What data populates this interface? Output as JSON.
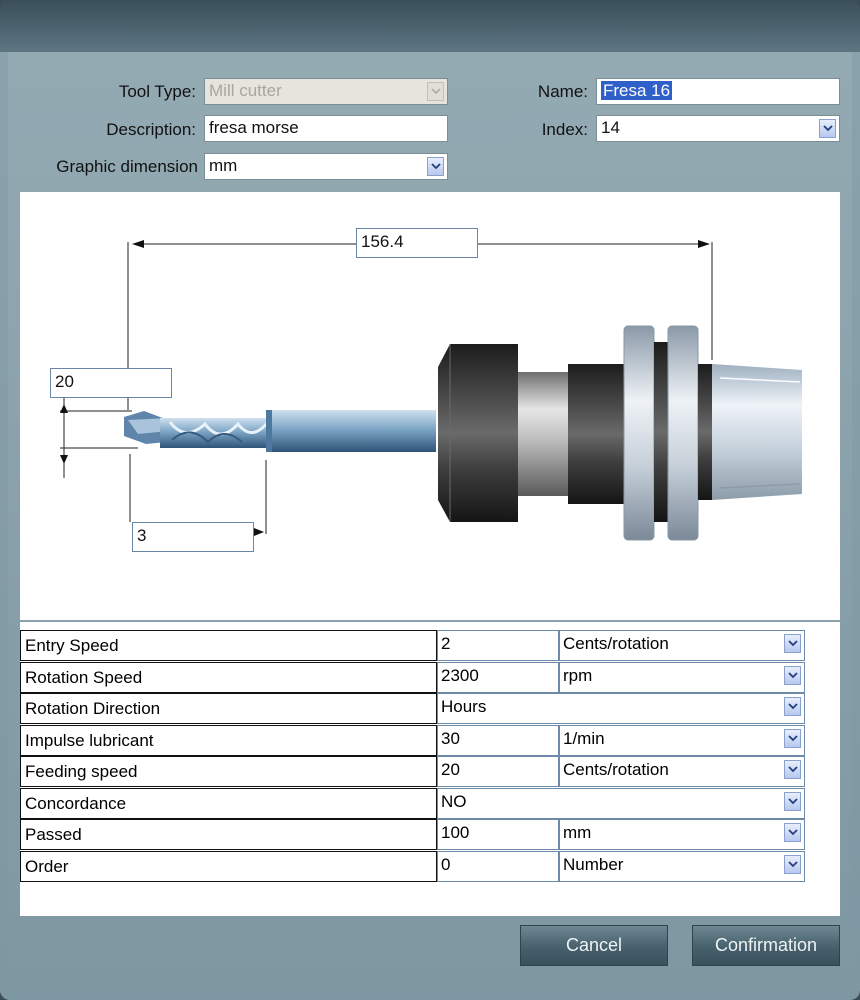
{
  "form": {
    "tool_type_label": "Tool Type:",
    "tool_type_value": "Mill cutter",
    "description_label": "Description:",
    "description_value": "fresa morse",
    "graphic_dimension_label": "Graphic dimension",
    "graphic_dimension_value": "mm",
    "name_label": "Name:",
    "name_value": "Fresa 16",
    "index_label": "Index:",
    "index_value": "14"
  },
  "drawing": {
    "length_value": "156.4",
    "diameter_value": "20",
    "offset_value": "3"
  },
  "params": [
    {
      "name": "Entry Speed",
      "value": "2",
      "unit": "Cents/rotation"
    },
    {
      "name": "Rotation Speed",
      "value": "2300",
      "unit": "rpm"
    },
    {
      "name": "Rotation Direction",
      "value": "Hours",
      "unit": ""
    },
    {
      "name": "Impulse lubricant",
      "value": "30",
      "unit": "1/min"
    },
    {
      "name": "Feeding speed",
      "value": "20",
      "unit": "Cents/rotation"
    },
    {
      "name": "Concordance",
      "value": "NO",
      "unit": ""
    },
    {
      "name": "Passed",
      "value": "100",
      "unit": "mm"
    },
    {
      "name": "Order",
      "value": "0",
      "unit": "Number"
    }
  ],
  "buttons": {
    "cancel_label": "Cancel",
    "confirm_label": "Confirmation"
  }
}
